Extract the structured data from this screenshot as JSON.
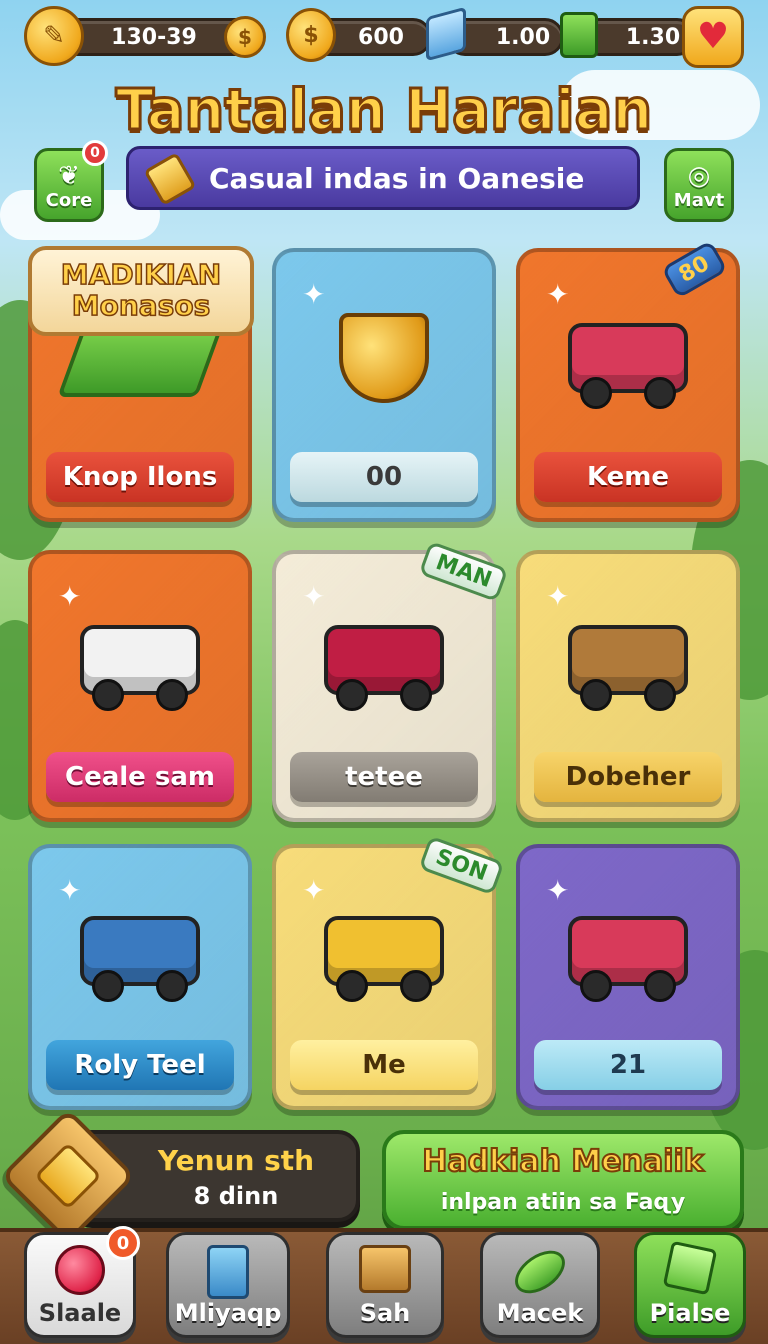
{
  "header": {
    "stat_1": "130-39",
    "stat_2": "600",
    "stat_3": "1.00",
    "stat_4": "1.30",
    "title": "Tantalan Haraian",
    "subtitle": "Casual indas in Oanesie",
    "left_button": "Core",
    "right_button": "Mavt",
    "left_badge": "0"
  },
  "cards": [
    {
      "name": "Knop Ilons",
      "banner": "MADIKIAN Monasos",
      "bg": "#f0762c"
    },
    {
      "name": "00",
      "bg": "#7cc8ec"
    },
    {
      "name": "Keme",
      "tag": "80",
      "bg": "#f0762c"
    },
    {
      "name": "Ceale sam",
      "bg": "#f0762c"
    },
    {
      "name": "tetee",
      "tag": "MAN",
      "bg": "#f4ecd8"
    },
    {
      "name": "Dobeher",
      "bg": "#f7dc7a"
    },
    {
      "name": "Roly Teel",
      "bg": "#7cc8ec"
    },
    {
      "name": "Me",
      "tag": "SON",
      "bg": "#f7dc7a"
    },
    {
      "name": "21",
      "bg": "#7e68c8"
    }
  ],
  "event": {
    "title": "Yenun sth",
    "timer": "8 dinn"
  },
  "promo": {
    "title": "Hadkiah Menaiik",
    "subtitle": "inlpan atiin sa Faɋy"
  },
  "nav": [
    {
      "label": "Slaale",
      "badge": "0"
    },
    {
      "label": "Mliyaqp"
    },
    {
      "label": "Sah"
    },
    {
      "label": "Macek"
    },
    {
      "label": "Pialse"
    }
  ]
}
